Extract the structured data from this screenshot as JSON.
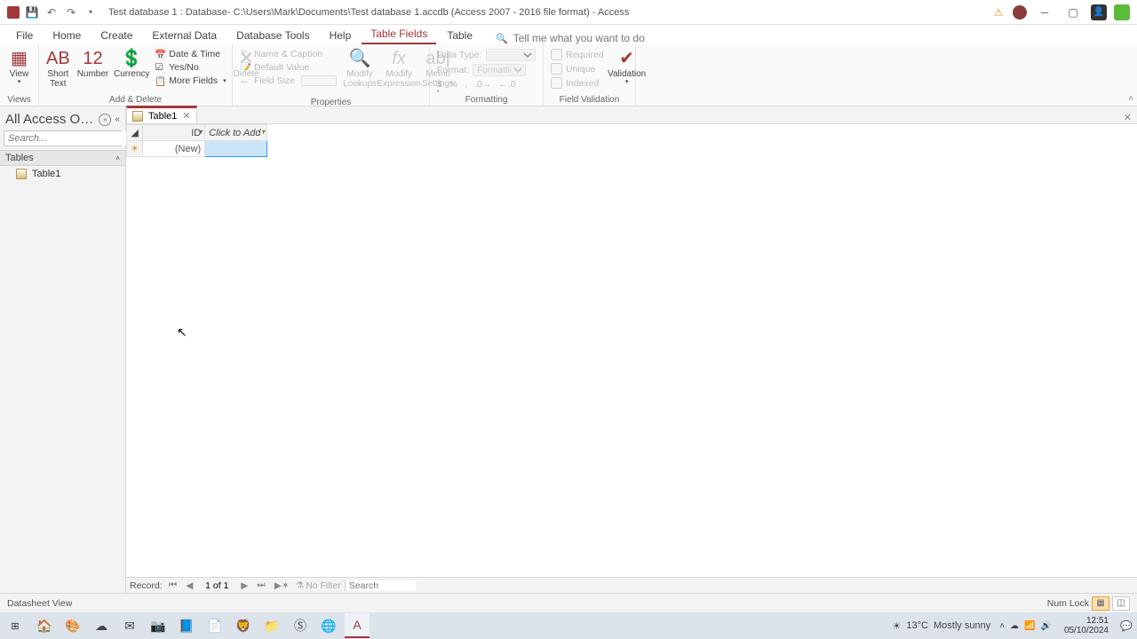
{
  "titlebar": {
    "title": "Test database 1 : Database- C:\\Users\\Mark\\Documents\\Test database 1.accdb (Access 2007 - 2016 file format)  -  Access"
  },
  "menu": {
    "file": "File",
    "home": "Home",
    "create": "Create",
    "external_data": "External Data",
    "database_tools": "Database Tools",
    "help": "Help",
    "table_fields": "Table Fields",
    "table": "Table",
    "search_placeholder": "Tell me what you want to do"
  },
  "ribbon": {
    "views": {
      "view": "View",
      "group": "Views"
    },
    "add_delete": {
      "short_text": "Short Text",
      "number": "Number",
      "currency": "Currency",
      "date_time": "Date & Time",
      "yes_no": "Yes/No",
      "more_fields": "More Fields",
      "delete": "Delete",
      "group": "Add & Delete"
    },
    "properties": {
      "name_caption": "Name & Caption",
      "default_value": "Default Value",
      "field_size": "Field Size",
      "modify_lookups": "Modify Lookups",
      "modify_expression": "Modify Expression",
      "memo_settings": "Memo Settings",
      "group": "Properties"
    },
    "formatting": {
      "data_type": "Data Type:",
      "format": "Format:",
      "format_placeholder": "Formatting",
      "group": "Formatting"
    },
    "validation": {
      "required": "Required",
      "unique": "Unique",
      "indexed": "Indexed",
      "validation": "Validation",
      "group": "Field Validation"
    }
  },
  "navpane": {
    "title": "All Access Obj...",
    "search_placeholder": "Search...",
    "group_tables": "Tables",
    "items": [
      "Table1"
    ]
  },
  "doctab": {
    "label": "Table1"
  },
  "datasheet": {
    "col_id": "ID",
    "col_add": "Click to Add",
    "row_new": "(New)"
  },
  "recordnav": {
    "label": "Record:",
    "position": "1 of 1",
    "nofilter": "No Filter",
    "search": "Search"
  },
  "statusbar": {
    "view": "Datasheet View",
    "numlock": "Num Lock"
  },
  "taskbar": {
    "weather_temp": "13°C",
    "weather_text": "Mostly sunny",
    "time": "12:51",
    "date": "05/10/2024"
  }
}
